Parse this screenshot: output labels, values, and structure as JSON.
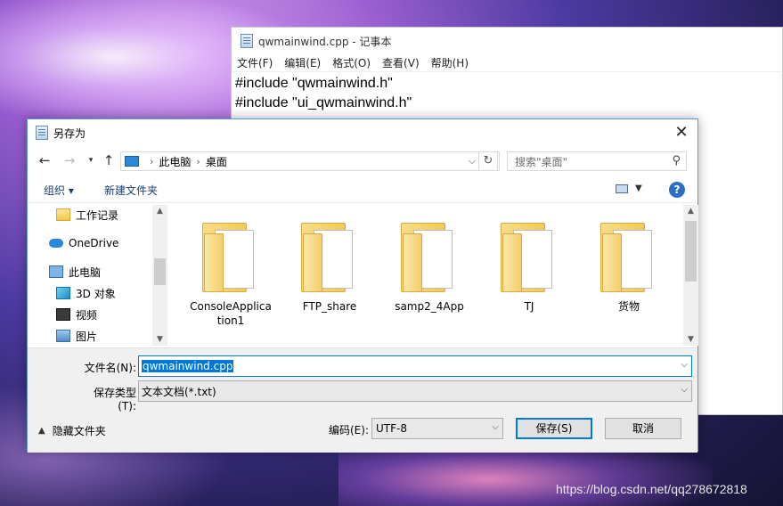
{
  "notepad": {
    "title": "qwmainwind.cpp - 记事本",
    "menu": [
      "文件(F)",
      "编辑(E)",
      "格式(O)",
      "查看(V)",
      "帮助(H)"
    ],
    "lines": [
      "#include \"qwmainwind.h\"",
      "#include \"ui_qwmainwind.h\""
    ]
  },
  "dialog": {
    "title": "另存为",
    "close": "✕",
    "address": {
      "root": "此电脑",
      "current": "桌面"
    },
    "search_placeholder": "搜索\"桌面\"",
    "toolbar": {
      "organize": "组织 ▾",
      "new_folder": "新建文件夹",
      "help": "?"
    },
    "nav_items": [
      {
        "label": "工作记录",
        "icon": "folder-icon"
      },
      {
        "label": "OneDrive",
        "icon": "onedrive-icon"
      },
      {
        "label": "此电脑",
        "icon": "computer-icon"
      },
      {
        "label": "3D 对象",
        "icon": "3d-objects-icon"
      },
      {
        "label": "视频",
        "icon": "video-icon"
      },
      {
        "label": "图片",
        "icon": "pictures-icon"
      }
    ],
    "files": [
      {
        "name": "ConsoleApplication1",
        "line1": "ConsoleApplica",
        "line2": "tion1"
      },
      {
        "name": "FTP_share",
        "line1": "FTP_share",
        "line2": ""
      },
      {
        "name": "samp2_4App",
        "line1": "samp2_4App",
        "line2": ""
      },
      {
        "name": "TJ",
        "line1": "TJ",
        "line2": ""
      },
      {
        "name": "货物",
        "line1": "货物",
        "line2": ""
      }
    ],
    "filename_label": "文件名(N):",
    "filename_value": "qwmainwind.cpp",
    "filetype_label": "保存类型(T):",
    "filetype_value": "文本文档(*.txt)",
    "hide_folders": "隐藏文件夹",
    "encoding_label": "编码(E):",
    "encoding_value": "UTF-8",
    "save_button": "保存(S)",
    "cancel_button": "取消"
  },
  "watermark": "https://blog.csdn.net/qq278672818"
}
